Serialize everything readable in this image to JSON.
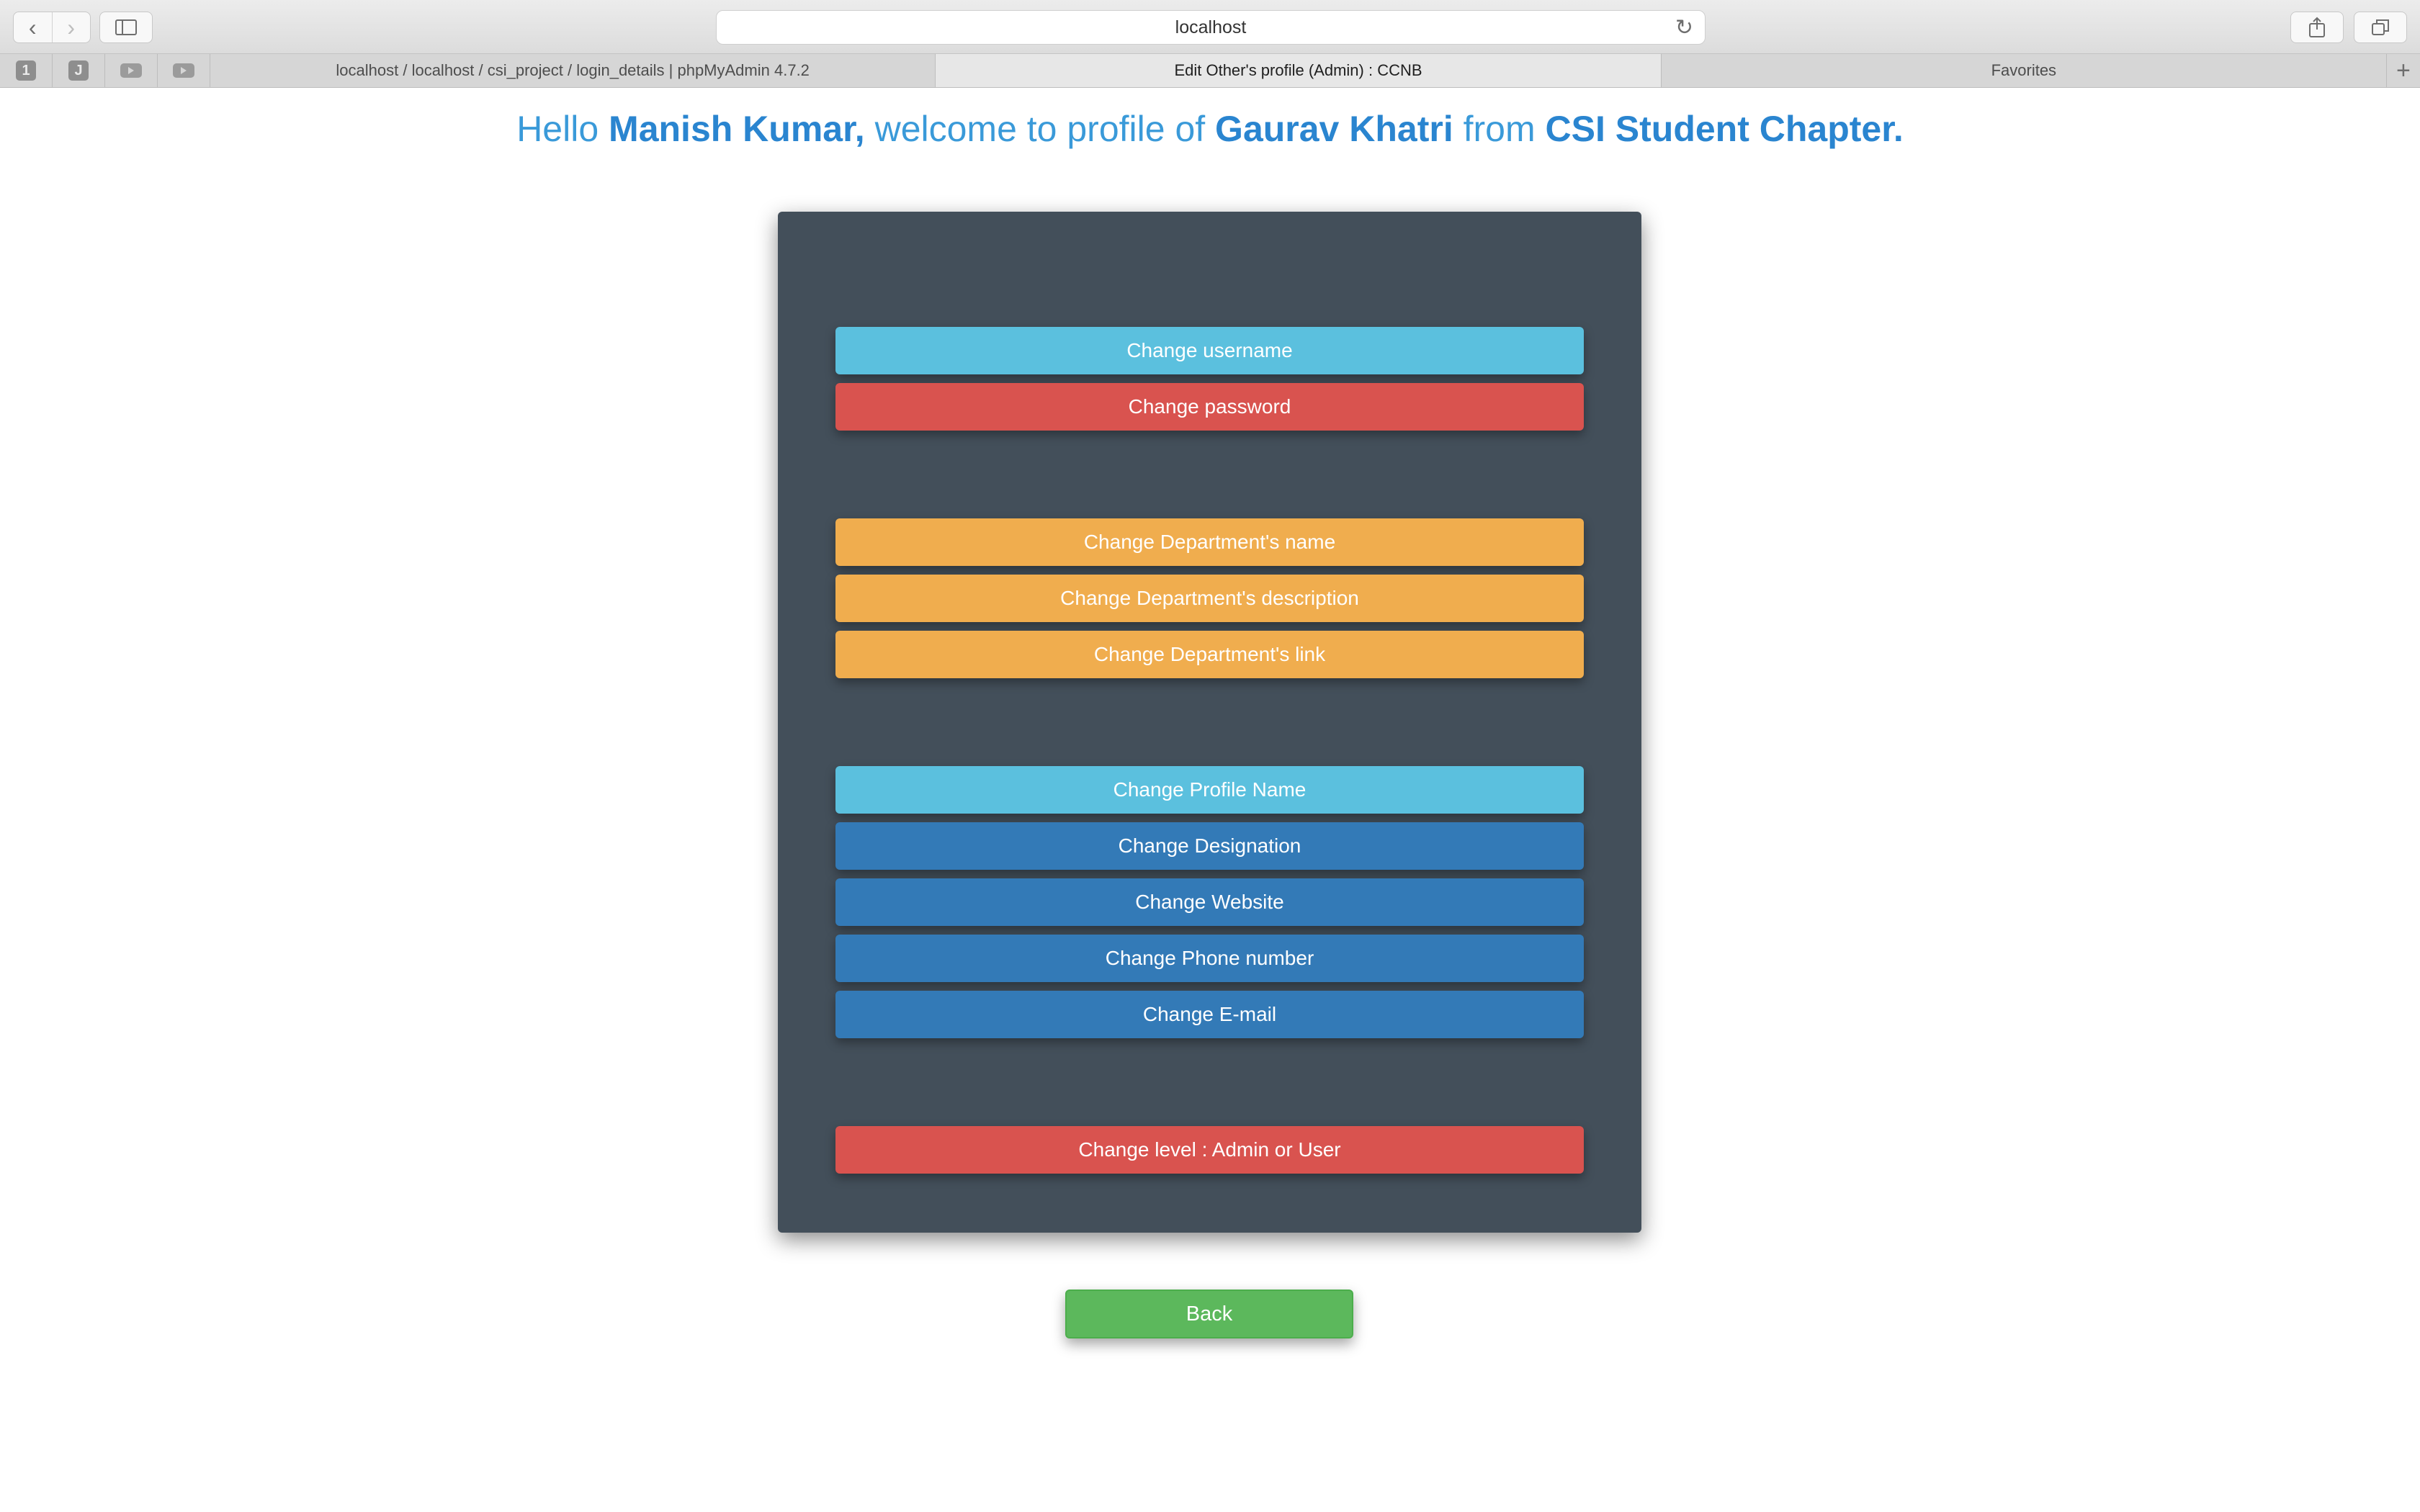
{
  "browser": {
    "address": "localhost",
    "pinned_tabs": [
      "1",
      "J"
    ],
    "tabs": [
      "localhost / localhost / csi_project / login_details | phpMyAdmin 4.7.2",
      "Edit Other's profile (Admin) : CCNB",
      "Favorites"
    ],
    "active_tab_index": 1
  },
  "greeting": {
    "hello": "Hello",
    "admin_name": "Manish Kumar,",
    "mid": "welcome to profile of",
    "profile_name": "Gaurav Khatri",
    "from": "from",
    "org": "CSI Student Chapter."
  },
  "account_actions": [
    "Change username",
    "Change password"
  ],
  "department_actions": [
    "Change Department's name",
    "Change Department's description",
    "Change Department's link"
  ],
  "profile_actions": [
    "Change Profile Name",
    "Change Designation",
    "Change Website",
    "Change Phone number",
    "Change E-mail"
  ],
  "level_action": "Change level : Admin or User",
  "back_label": "Back",
  "colors": {
    "info": "#5bc0de",
    "danger": "#d9534f",
    "warning": "#f0ad4e",
    "primary": "#337ab7",
    "success": "#5cb85c",
    "panel": "#434f5a",
    "heading": "#3a9ad9"
  }
}
